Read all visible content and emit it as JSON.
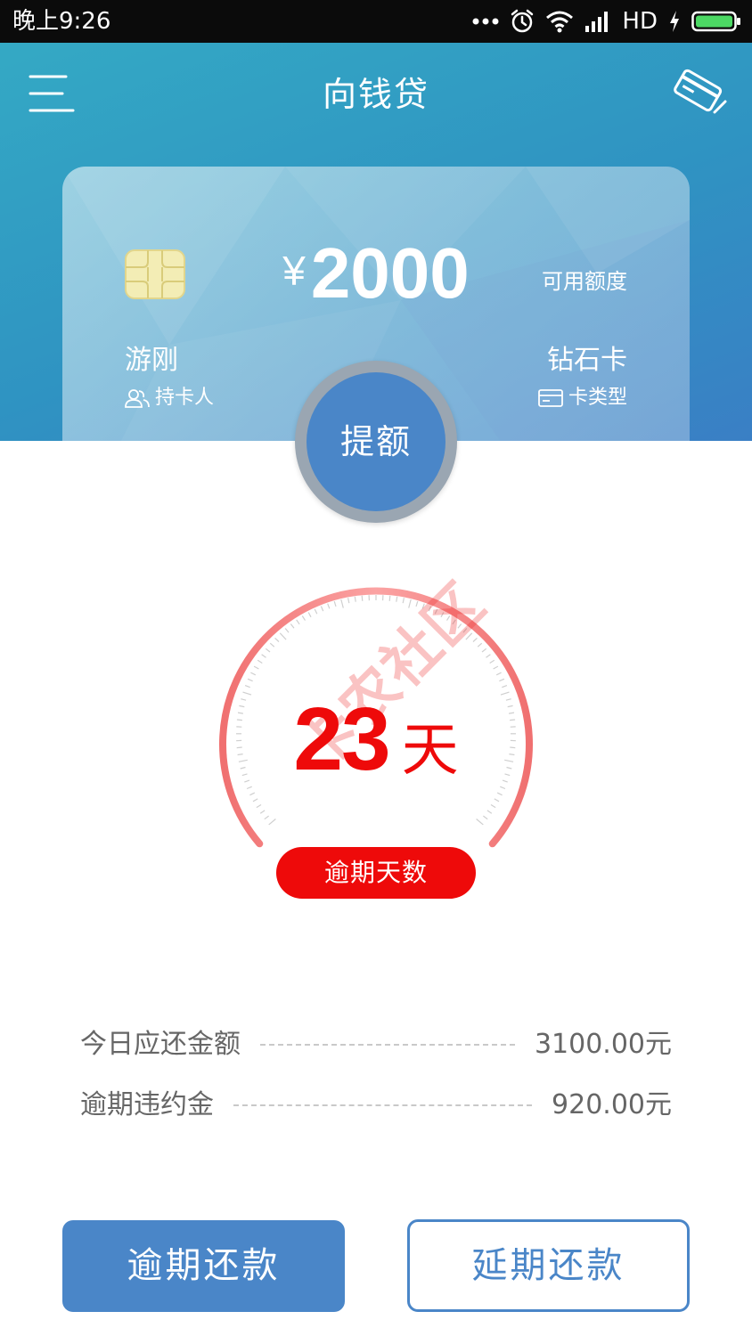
{
  "status_bar": {
    "time": "晚上9:26",
    "network": "HD",
    "icons": [
      "more-dots-icon",
      "alarm-icon",
      "wifi-icon",
      "signal-icon",
      "charging-icon",
      "battery-icon"
    ]
  },
  "header": {
    "title": "向钱贷",
    "menu_icon": "menu-icon",
    "card_icon": "card-swipe-icon"
  },
  "card": {
    "currency_symbol": "¥",
    "amount": "2000",
    "amount_label": "可用额度",
    "holder_name": "游刚",
    "holder_label": "持卡人",
    "card_type": "钻石卡",
    "card_type_label": "卡类型"
  },
  "raise_limit": {
    "label": "提额"
  },
  "overdue": {
    "days": "23",
    "unit": "天",
    "label": "逾期天数"
  },
  "watermark": {
    "text": "卡农社区"
  },
  "amounts": [
    {
      "label": "今日应还金额",
      "value": "3100.00元"
    },
    {
      "label": "逾期违约金",
      "value": "920.00元"
    }
  ],
  "actions": {
    "overdue_repay": "逾期还款",
    "defer_repay": "延期还款"
  },
  "colors": {
    "header_start": "#34a9c4",
    "header_end": "#3a7fc5",
    "primary_blue": "#4a86c8",
    "alert_red": "#ee0a0a",
    "text_gray": "#666666"
  }
}
